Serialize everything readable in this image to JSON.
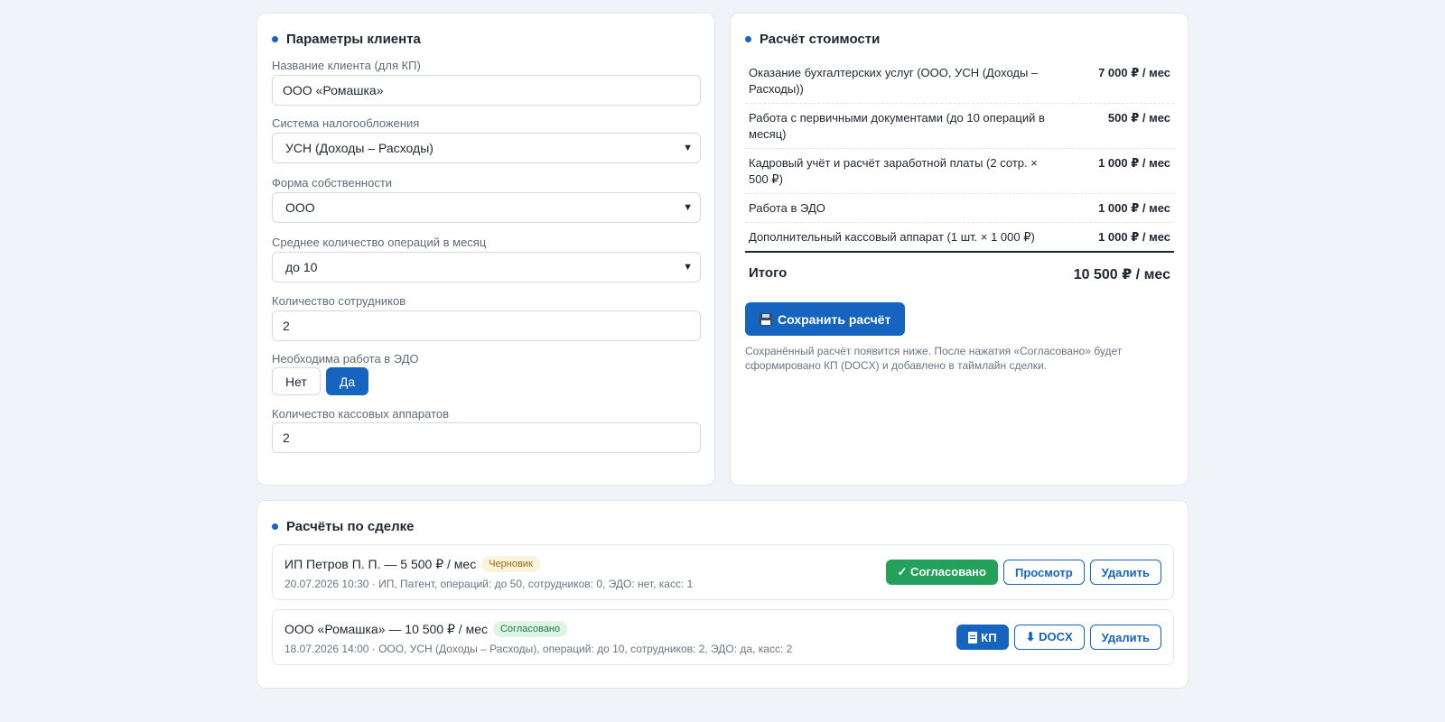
{
  "client_params": {
    "title": "Параметры клиента",
    "client_name_label": "Название клиента (для КП)",
    "client_name_value": "ООО «Ромашка»",
    "tax_label": "Система налогообложения",
    "tax_value": "УСН (Доходы – Расходы)",
    "ownership_label": "Форма собственности",
    "ownership_value": "ООО",
    "operations_label": "Среднее количество операций в месяц",
    "operations_value": "до 10",
    "employees_label": "Количество сотрудников",
    "employees_value": "2",
    "edo_label": "Необходима работа в ЭДО",
    "edo_no": "Нет",
    "edo_yes": "Да",
    "edo_selected": "Да",
    "cash_label": "Количество кассовых аппаратов",
    "cash_value": "2"
  },
  "calc": {
    "title": "Расчёт стоимости",
    "rows": [
      {
        "name": "Оказание бухгалтерских услуг (ООО, УСН (Доходы – Расходы))",
        "price": "7 000 ₽ / мес"
      },
      {
        "name": "Работа с первичными документами (до 10 операций в месяц)",
        "price": "500 ₽ / мес"
      },
      {
        "name": "Кадровый учёт и расчёт заработной платы (2 сотр. × 500 ₽)",
        "price": "1 000 ₽ / мес"
      },
      {
        "name": "Работа в ЭДО",
        "price": "1 000 ₽ / мес"
      },
      {
        "name": "Дополнительный кассовый аппарат (1 шт. × 1 000 ₽)",
        "price": "1 000 ₽ / мес"
      }
    ],
    "total_label": "Итого",
    "total_value": "10 500 ₽ / мес",
    "save_label": "Сохранить расчёт",
    "hint": "Сохранённый расчёт появится ниже. После нажатия «Согласовано» будет сформировано КП (DOCX) и добавлено в таймлайн сделки."
  },
  "deals": {
    "title": "Расчёты по сделке",
    "items": [
      {
        "title": "ИП Петров П. П. — 5 500 ₽ / мес",
        "badge": "Черновик",
        "meta": "20.07.2026 10:30 · ИП, Патент, операций: до 50, сотрудников: 0, ЭДО: нет, касс: 1",
        "approve_label": "✓ Согласовано",
        "view_label": "Просмотр",
        "delete_label": "Удалить"
      },
      {
        "title": "ООО «Ромашка» — 10 500 ₽ / мес",
        "badge": "Согласовано",
        "meta": "18.07.2026 14:00 · ООО, УСН (Доходы – Расходы), операций: до 10, сотрудников: 2, ЭДО: да, касс: 2",
        "kp_label": "КП",
        "docx_label": "⬇ DOCX",
        "delete_label": "Удалить"
      }
    ]
  },
  "colors": {
    "accent": "#1565c0",
    "success": "#23a05a",
    "background": "#f0f3f7"
  }
}
